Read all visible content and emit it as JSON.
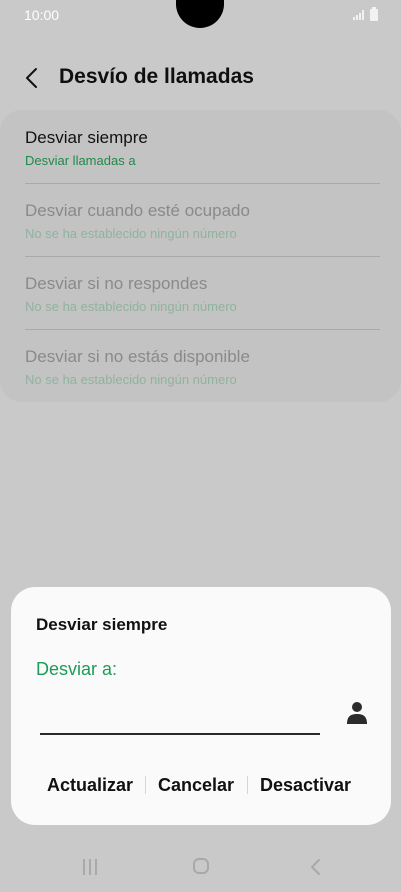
{
  "status": {
    "time": "10:00"
  },
  "header": {
    "title": "Desvío de llamadas"
  },
  "options": [
    {
      "title": "Desviar siempre",
      "subtitle": "Desviar llamadas a"
    },
    {
      "title": "Desviar cuando esté ocupado",
      "subtitle": "No se ha establecido ningún número"
    },
    {
      "title": "Desviar si no respondes",
      "subtitle": "No se ha establecido ningún número"
    },
    {
      "title": "Desviar si no estás disponible",
      "subtitle": "No se ha establecido ningún número"
    }
  ],
  "dialog": {
    "title": "Desviar siempre",
    "label": "Desviar a:",
    "input_value": "",
    "update": "Actualizar",
    "cancel": "Cancelar",
    "deactivate": "Desactivar"
  },
  "colors": {
    "accent": "#1e9b58",
    "scrim": "#c9c9c9"
  },
  "icons": {
    "back": "back-arrow-icon",
    "contact": "contact-person-icon"
  }
}
